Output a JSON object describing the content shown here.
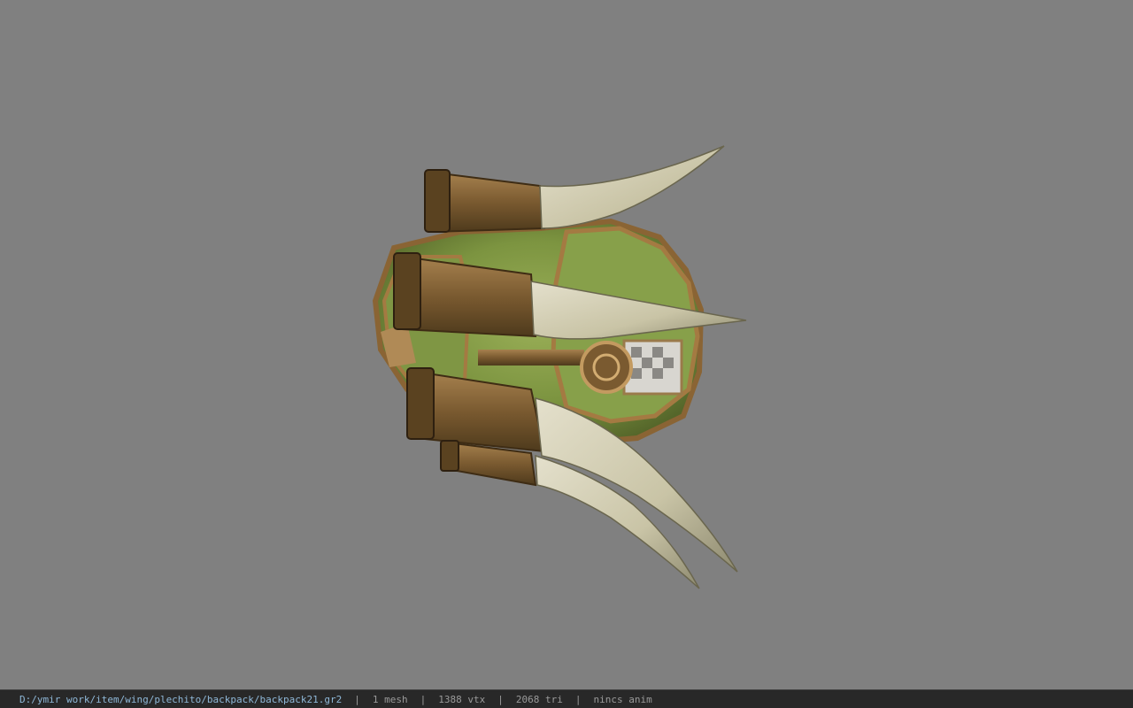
{
  "status_bar": {
    "file_path": "D:/ymir work/item/wing/plechito/backpack/backpack21.gr2",
    "separator": "|",
    "mesh_count": "1 mesh",
    "vertex_count": "1388 vtx",
    "triangle_count": "2068 tri",
    "animation": "nincs anim"
  },
  "colors": {
    "viewport_background": "#808080",
    "status_background": "#282828",
    "path_text": "#8fb8d8",
    "stat_text": "#9a9a9a"
  }
}
